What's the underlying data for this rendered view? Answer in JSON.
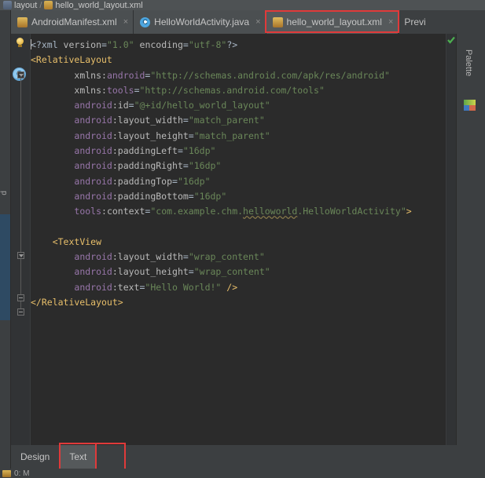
{
  "breadcrumb": {
    "items": [
      {
        "label": "layout",
        "icon": "folder-icon"
      },
      {
        "label": "hello_world_layout.xml",
        "icon": "xml-file-icon"
      }
    ],
    "separator": "/"
  },
  "editor_tabs": {
    "items": [
      {
        "label": "AndroidManifest.xml",
        "icon": "xml-file-icon",
        "close": "×",
        "active": false
      },
      {
        "label": "HelloWorldActivity.java",
        "icon": "java-class-icon",
        "close": "×",
        "active": false
      },
      {
        "label": "hello_world_layout.xml",
        "icon": "xml-file-icon",
        "close": "×",
        "active": true,
        "annotated": true
      }
    ]
  },
  "preview_panel": {
    "title": "Previ",
    "palette_label": "Palette",
    "palette_icon": "palette-icon"
  },
  "left_tool_strip": {
    "label": "d"
  },
  "gutter": {
    "intention_icon": "lightbulb-icon",
    "class_marker_icon": "class-marker-icon",
    "class_marker_letter": "C"
  },
  "inspection": {
    "status_icon": "green-check-icon",
    "status": "ok"
  },
  "code": {
    "language": "xml",
    "lines": [
      [
        {
          "t": "<?xml ",
          "c": "s-proc"
        },
        {
          "t": "version",
          "c": "s-attr"
        },
        {
          "t": "=",
          "c": "s-punct"
        },
        {
          "t": "\"1.0\"",
          "c": "s-val"
        },
        {
          "t": " ",
          "c": "s-punct"
        },
        {
          "t": "encoding",
          "c": "s-attr"
        },
        {
          "t": "=",
          "c": "s-punct"
        },
        {
          "t": "\"utf-8\"",
          "c": "s-val"
        },
        {
          "t": "?>",
          "c": "s-proc"
        }
      ],
      [
        {
          "t": "<RelativeLayout",
          "c": "s-tag"
        }
      ],
      [
        {
          "t": "        ",
          "c": "s-punct"
        },
        {
          "t": "xmlns:",
          "c": "s-attr"
        },
        {
          "t": "android",
          "c": "s-ns"
        },
        {
          "t": "=",
          "c": "s-punct"
        },
        {
          "t": "\"http://schemas.android.com/apk/res/android\"",
          "c": "s-val"
        }
      ],
      [
        {
          "t": "        ",
          "c": "s-punct"
        },
        {
          "t": "xmlns:",
          "c": "s-attr"
        },
        {
          "t": "tools",
          "c": "s-ns"
        },
        {
          "t": "=",
          "c": "s-punct"
        },
        {
          "t": "\"http://schemas.android.com/tools\"",
          "c": "s-val"
        }
      ],
      [
        {
          "t": "        ",
          "c": "s-punct"
        },
        {
          "t": "android",
          "c": "s-ns"
        },
        {
          "t": ":id",
          "c": "s-attr"
        },
        {
          "t": "=",
          "c": "s-punct"
        },
        {
          "t": "\"@+id/hello_world_layout\"",
          "c": "s-val"
        }
      ],
      [
        {
          "t": "        ",
          "c": "s-punct"
        },
        {
          "t": "android",
          "c": "s-ns"
        },
        {
          "t": ":layout_width",
          "c": "s-attr"
        },
        {
          "t": "=",
          "c": "s-punct"
        },
        {
          "t": "\"match_parent\"",
          "c": "s-val"
        }
      ],
      [
        {
          "t": "        ",
          "c": "s-punct"
        },
        {
          "t": "android",
          "c": "s-ns"
        },
        {
          "t": ":layout_height",
          "c": "s-attr"
        },
        {
          "t": "=",
          "c": "s-punct"
        },
        {
          "t": "\"match_parent\"",
          "c": "s-val"
        }
      ],
      [
        {
          "t": "        ",
          "c": "s-punct"
        },
        {
          "t": "android",
          "c": "s-ns"
        },
        {
          "t": ":paddingLeft",
          "c": "s-attr"
        },
        {
          "t": "=",
          "c": "s-punct"
        },
        {
          "t": "\"16dp\"",
          "c": "s-val"
        }
      ],
      [
        {
          "t": "        ",
          "c": "s-punct"
        },
        {
          "t": "android",
          "c": "s-ns"
        },
        {
          "t": ":paddingRight",
          "c": "s-attr"
        },
        {
          "t": "=",
          "c": "s-punct"
        },
        {
          "t": "\"16dp\"",
          "c": "s-val"
        }
      ],
      [
        {
          "t": "        ",
          "c": "s-punct"
        },
        {
          "t": "android",
          "c": "s-ns"
        },
        {
          "t": ":paddingTop",
          "c": "s-attr"
        },
        {
          "t": "=",
          "c": "s-punct"
        },
        {
          "t": "\"16dp\"",
          "c": "s-val"
        }
      ],
      [
        {
          "t": "        ",
          "c": "s-punct"
        },
        {
          "t": "android",
          "c": "s-ns"
        },
        {
          "t": ":paddingBottom",
          "c": "s-attr"
        },
        {
          "t": "=",
          "c": "s-punct"
        },
        {
          "t": "\"16dp\"",
          "c": "s-val"
        }
      ],
      [
        {
          "t": "        ",
          "c": "s-punct"
        },
        {
          "t": "tools",
          "c": "s-ns"
        },
        {
          "t": ":context",
          "c": "s-attr"
        },
        {
          "t": "=",
          "c": "s-punct"
        },
        {
          "t": "\"com.example.chm.",
          "c": "s-val"
        },
        {
          "t": "helloworld",
          "c": "s-val underline-wavy"
        },
        {
          "t": ".HelloWorldActivity\"",
          "c": "s-val"
        },
        {
          "t": ">",
          "c": "s-tag"
        }
      ],
      [],
      [
        {
          "t": "    ",
          "c": "s-punct"
        },
        {
          "t": "<TextView",
          "c": "s-tag"
        }
      ],
      [
        {
          "t": "        ",
          "c": "s-punct"
        },
        {
          "t": "android",
          "c": "s-ns"
        },
        {
          "t": ":layout_width",
          "c": "s-attr"
        },
        {
          "t": "=",
          "c": "s-punct"
        },
        {
          "t": "\"wrap_content\"",
          "c": "s-val"
        }
      ],
      [
        {
          "t": "        ",
          "c": "s-punct"
        },
        {
          "t": "android",
          "c": "s-ns"
        },
        {
          "t": ":layout_height",
          "c": "s-attr"
        },
        {
          "t": "=",
          "c": "s-punct"
        },
        {
          "t": "\"wrap_content\"",
          "c": "s-val"
        }
      ],
      [
        {
          "t": "        ",
          "c": "s-punct"
        },
        {
          "t": "android",
          "c": "s-ns"
        },
        {
          "t": ":text",
          "c": "s-attr"
        },
        {
          "t": "=",
          "c": "s-punct"
        },
        {
          "t": "\"Hello World!\"",
          "c": "s-val"
        },
        {
          "t": " />",
          "c": "s-tag"
        }
      ],
      [
        {
          "t": "</RelativeLayout>",
          "c": "s-tag"
        }
      ]
    ]
  },
  "bottom_tabs": {
    "items": [
      {
        "label": "Design",
        "active": false
      },
      {
        "label": "Text",
        "active": true,
        "annotated": true
      }
    ]
  },
  "statusbar": {
    "icon": "project-icon",
    "text": "0: M"
  },
  "colors": {
    "window_bg": "#3c3f41",
    "editor_bg": "#2b2b2b",
    "gutter_bg": "#313335",
    "active_tab_bg": "#55595b",
    "annotation_red": "#e03a3a",
    "tag": "#e8bf6a",
    "namespace": "#9876aa",
    "attribute": "#bababa",
    "value": "#6a8759",
    "text": "#a9b7c6"
  }
}
